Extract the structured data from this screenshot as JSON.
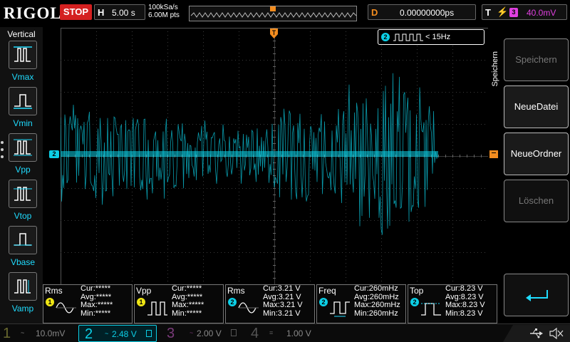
{
  "header": {
    "logo": "RIGOL",
    "run_state": "STOP",
    "timebase_letter": "H",
    "timebase": "5.00 s",
    "sample_rate": "100kSa/s",
    "memory_depth": "6.00M pts",
    "delay_letter": "D",
    "delay": "0.00000000ps",
    "trigger_letter": "T",
    "trigger_source": "3",
    "trigger_level": "40.0mV"
  },
  "sidebar": {
    "title": "Vertical",
    "items": [
      {
        "label": "Vmax",
        "icon": "vmax-icon"
      },
      {
        "label": "Vmin",
        "icon": "vmin-icon"
      },
      {
        "label": "Vpp",
        "icon": "vpp-icon"
      },
      {
        "label": "Vtop",
        "icon": "vtop-icon"
      },
      {
        "label": "Vbase",
        "icon": "vbase-icon"
      },
      {
        "label": "Vamp",
        "icon": "vamp-icon"
      }
    ]
  },
  "grid": {
    "channel_marker": "2",
    "freq_display_channel": "2",
    "freq_display_text": "< 15Hz"
  },
  "menu": {
    "title": "Speichern",
    "buttons": [
      {
        "label": "Speichern",
        "state": "dim"
      },
      {
        "label": "NeueDatei",
        "state": "enabled"
      },
      {
        "label": "NeueOrdner",
        "state": "enabled"
      },
      {
        "label": "Löschen",
        "state": "dim"
      },
      {
        "label": "",
        "icon": "return-arrow-icon",
        "state": "enabled"
      }
    ]
  },
  "measurements": [
    {
      "name": "Rms",
      "channel": "1",
      "channel_color": "#f0e614",
      "cur": "Cur:*****",
      "avg": "Avg:*****",
      "max": "Max:*****",
      "min": "Min:*****"
    },
    {
      "name": "Vpp",
      "channel": "1",
      "channel_color": "#f0e614",
      "cur": "Cur:*****",
      "avg": "Avg:*****",
      "max": "Max:*****",
      "min": "Min:*****"
    },
    {
      "name": "Rms",
      "channel": "2",
      "channel_color": "#0ccfe6",
      "cur": "Cur:3.21 V",
      "avg": "Avg:3.21 V",
      "max": "Max:3.21 V",
      "min": "Min:3.21 V"
    },
    {
      "name": "Freq",
      "channel": "2",
      "channel_color": "#0ccfe6",
      "cur": "Cur:260mHz",
      "avg": "Avg:260mHz",
      "max": "Max:260mHz",
      "min": "Min:260mHz"
    },
    {
      "name": "Top",
      "channel": "2",
      "channel_color": "#0ccfe6",
      "cur": "Cur:8.23 V",
      "avg": "Avg:8.23 V",
      "max": "Max:8.23 V",
      "min": "Min:8.23 V"
    }
  ],
  "channels": [
    {
      "number": "1",
      "coupling": "~",
      "scale": "10.0mV",
      "color": "#6a6a30"
    },
    {
      "number": "2",
      "coupling": "~",
      "scale": "2.48 V",
      "color": "#0ccfe6"
    },
    {
      "number": "3",
      "coupling": "~",
      "scale": "2.00 V",
      "color": "#7a3a7a"
    },
    {
      "number": "4",
      "coupling": "≡",
      "scale": "1.00 V",
      "color": "#505050"
    }
  ],
  "colors": {
    "ch1": "#f0e614",
    "ch2": "#0ccfe6",
    "ch3": "#e040e0",
    "trigger": "#f28c1f",
    "stop": "#d42020"
  }
}
